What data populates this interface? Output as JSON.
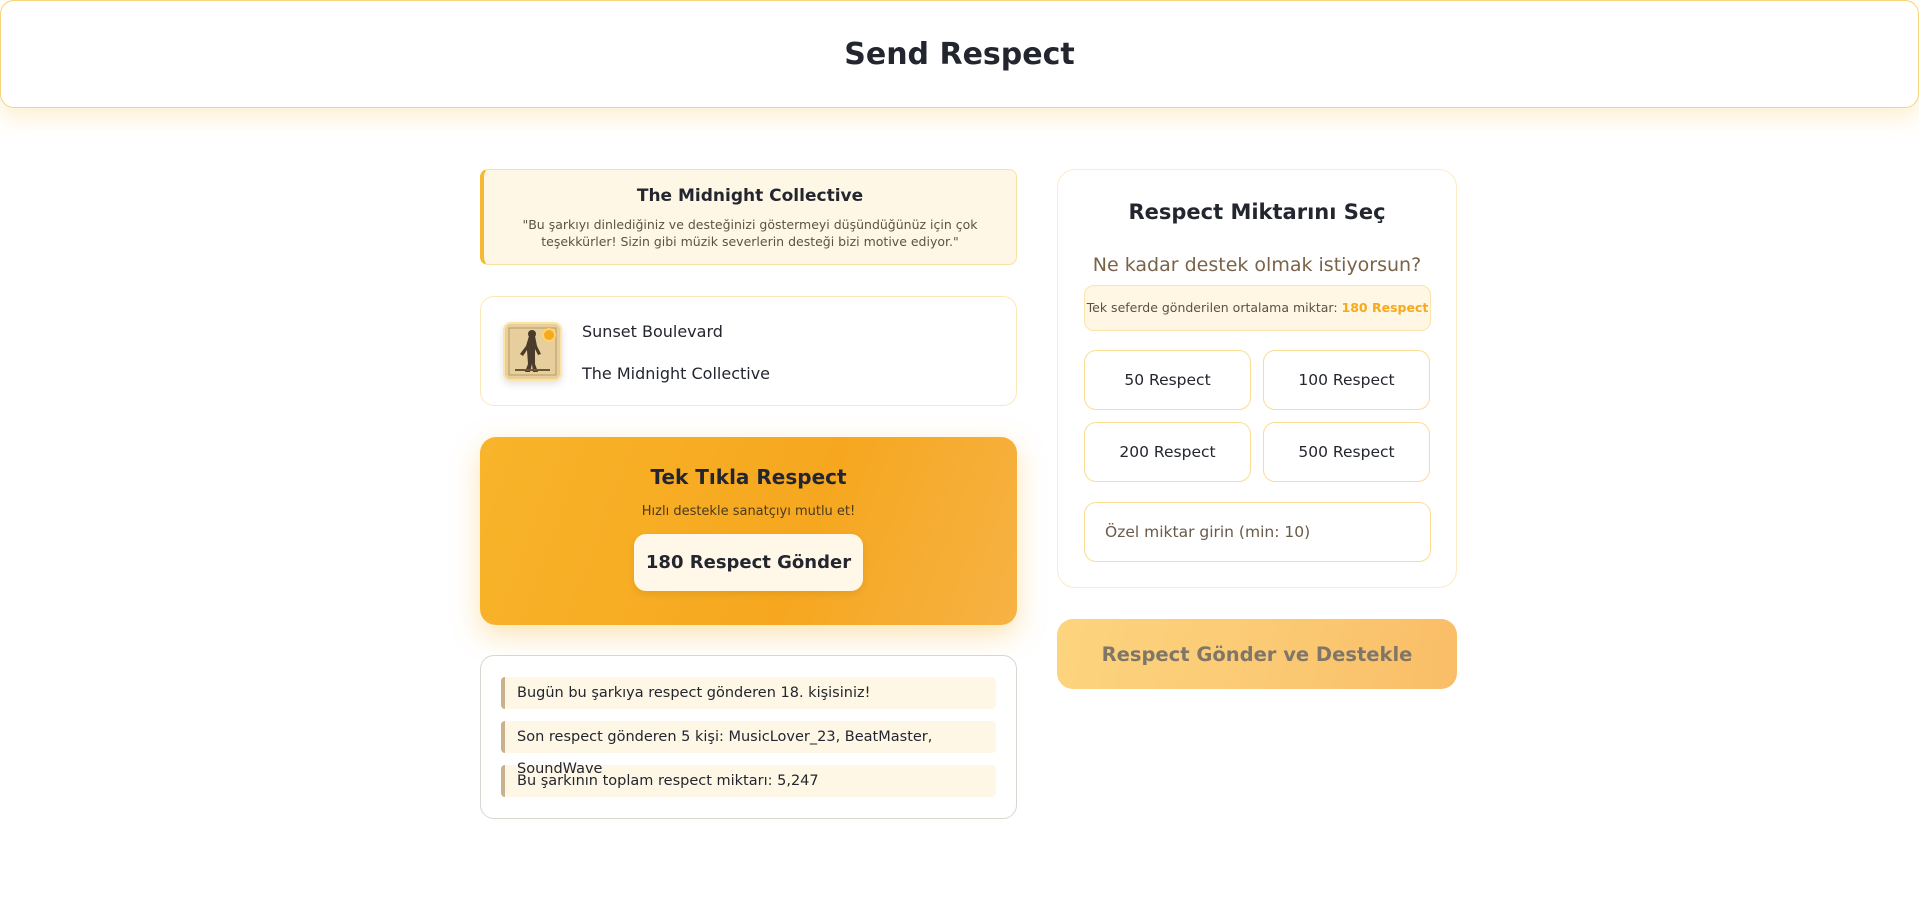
{
  "header": {
    "title": "Send Respect"
  },
  "artist_message": {
    "artist": "The Midnight Collective",
    "message": "\"Bu şarkıyı dinlediğiniz ve desteğinizi göstermeyi düşündüğünüz için çok teşekkürler! Sizin gibi müzik severlerin desteği bizi motive ediyor.\""
  },
  "song": {
    "title": "Sunset Boulevard",
    "artist": "The Midnight Collective",
    "cover_icon": "album-cover-icon"
  },
  "quick_respect": {
    "title": "Tek Tıkla Respect",
    "subtitle": "Hızlı destekle sanatçıyı mutlu et!",
    "button_label": "180 Respect Gönder"
  },
  "stats": [
    "Bugün bu şarkıya respect gönderen 18. kişisiniz!",
    "Son respect gönderen 5 kişi: MusicLover_23, BeatMaster, SoundWave",
    "Bu şarkının toplam respect miktarı: 5,247"
  ],
  "amount": {
    "title": "Respect Miktarını Seç",
    "question": "Ne kadar destek olmak istiyorsun?",
    "average_prefix": "Tek seferde gönderilen ortalama miktar:",
    "average_value": "180 Respect",
    "options": [
      "50 Respect",
      "100 Respect",
      "200 Respect",
      "500 Respect"
    ],
    "custom_placeholder": "Özel miktar girin (min: 10)",
    "custom_value": ""
  },
  "submit": {
    "label": "Respect Gönder ve Destekle"
  },
  "colors": {
    "accent": "#f6a91e",
    "accent_light": "#fff7e6",
    "border": "#fbdc95",
    "text": "#23262f"
  }
}
